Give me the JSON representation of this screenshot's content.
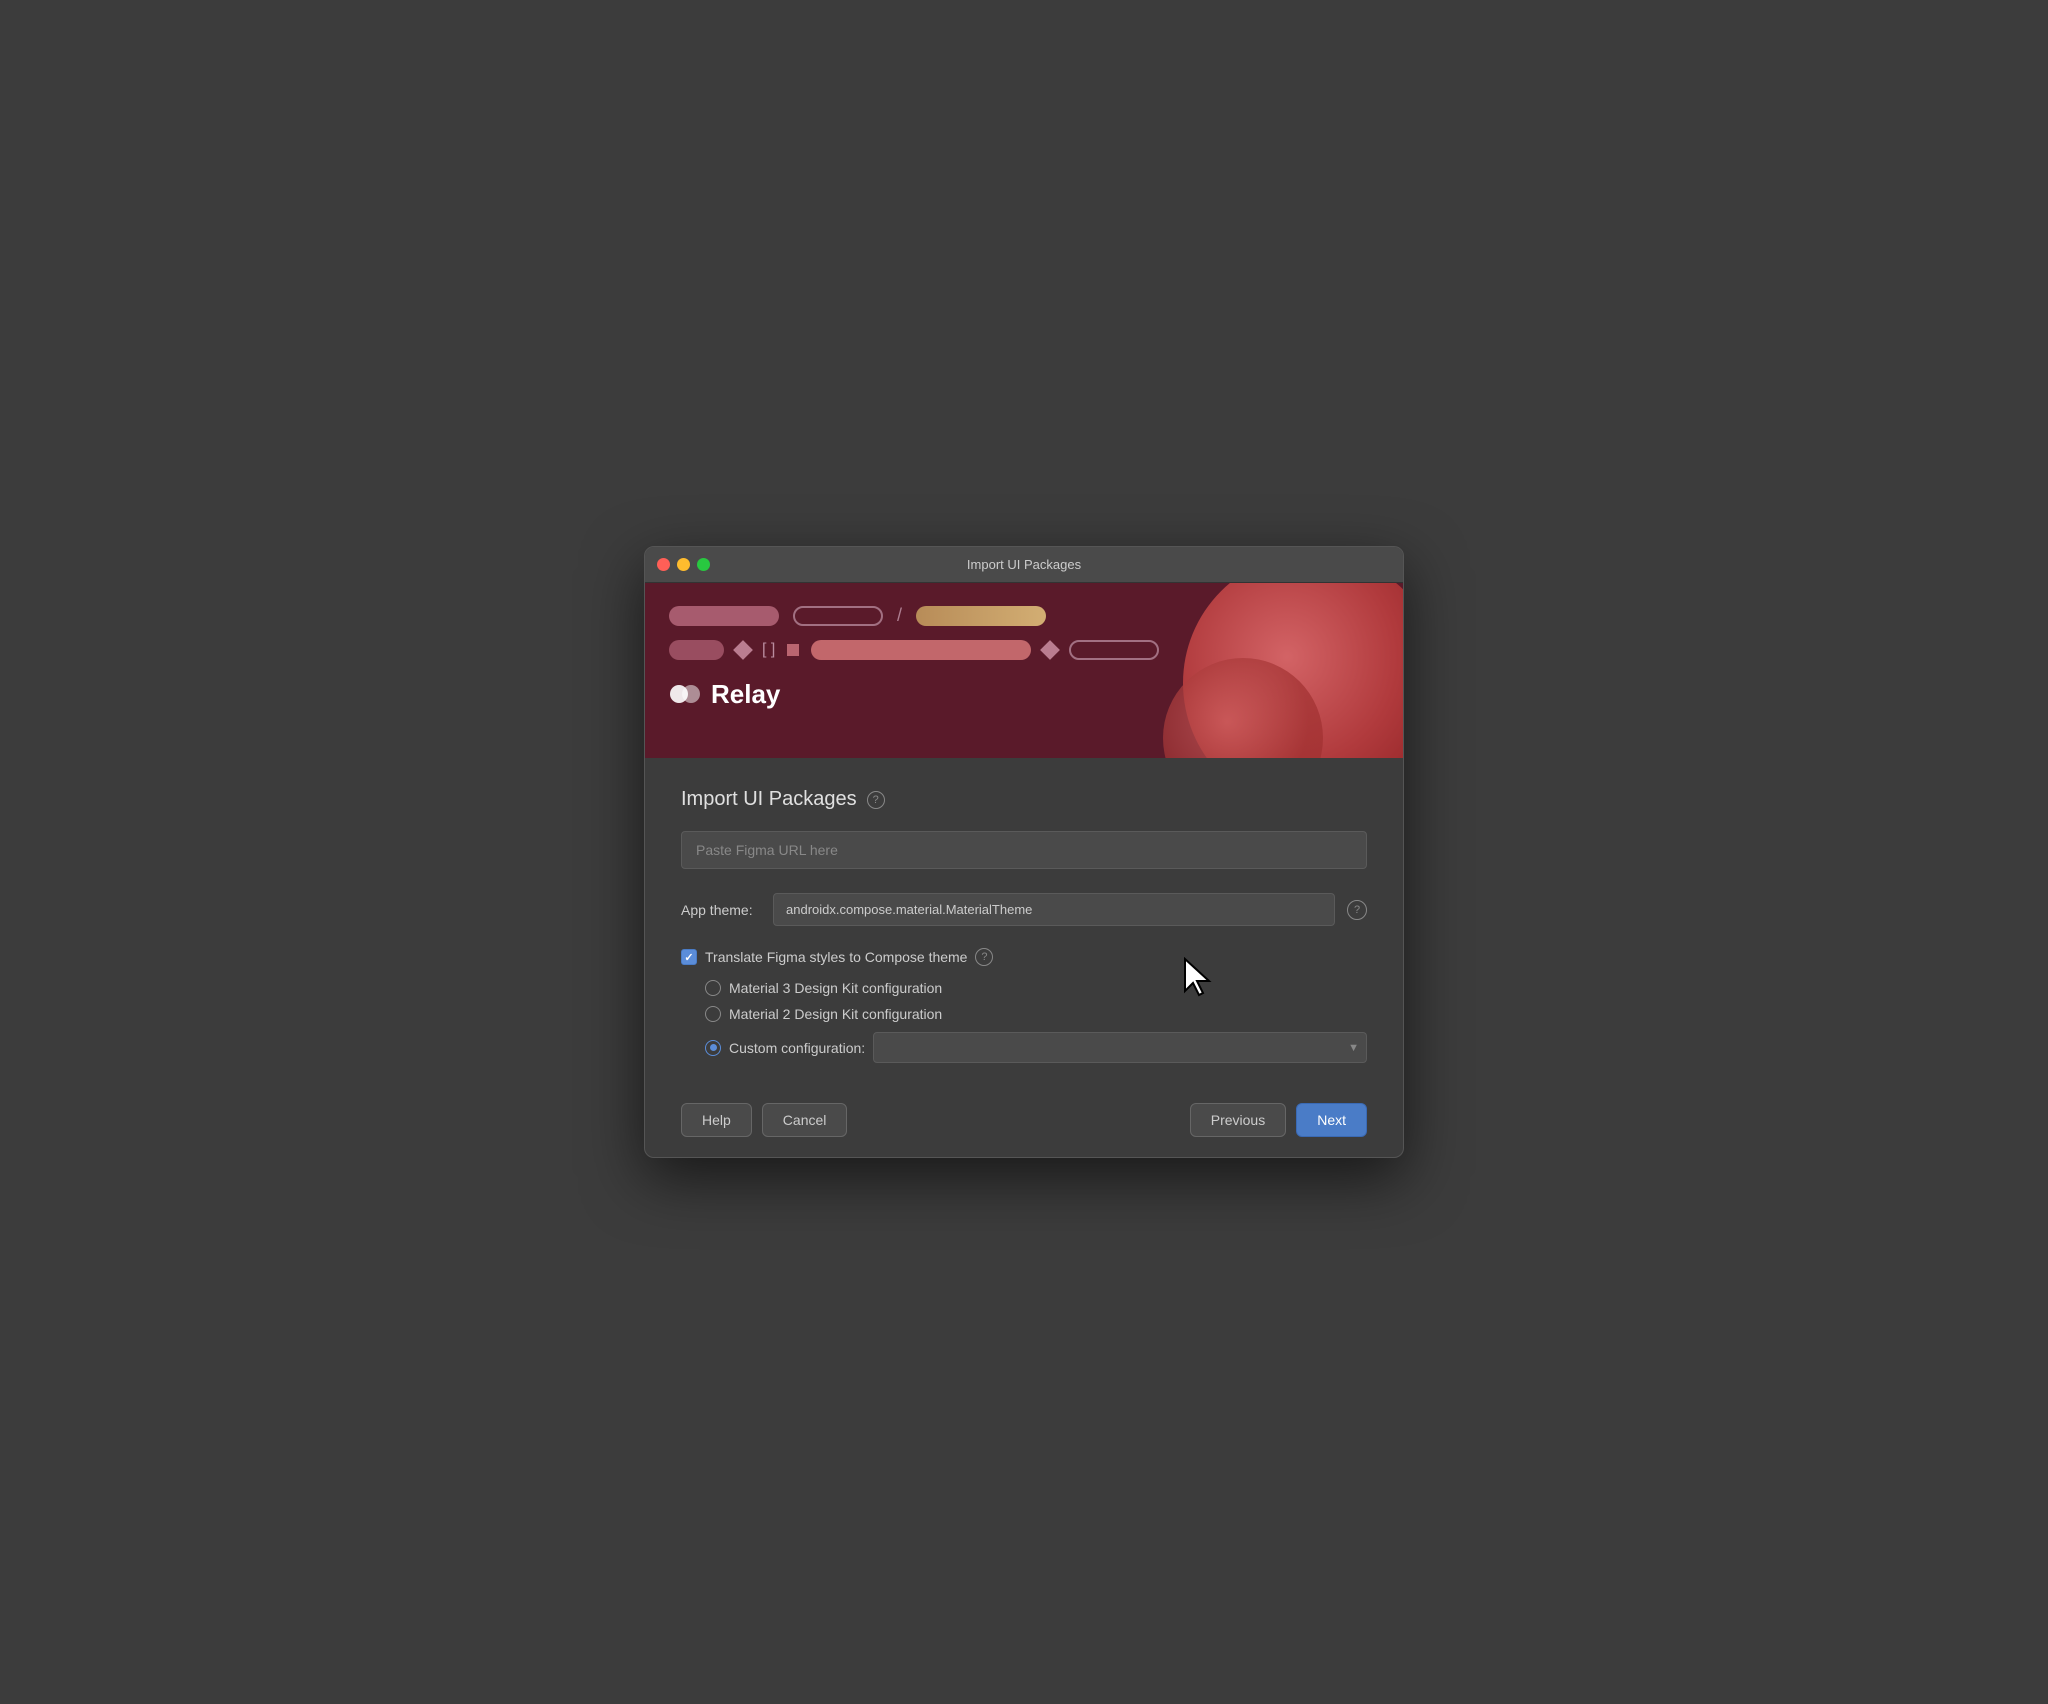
{
  "window": {
    "title": "Import UI Packages"
  },
  "hero": {
    "relay_logo_text": "Relay"
  },
  "page": {
    "title": "Import UI Packages",
    "help_icon": "?",
    "url_input_placeholder": "Paste Figma URL here",
    "app_theme_label": "App theme:",
    "app_theme_value": "androidx.compose.material.MaterialTheme",
    "app_theme_help": "?",
    "translate_checkbox_label": "Translate Figma styles to Compose theme",
    "translate_help": "?",
    "radio_material3_label": "Material 3 Design Kit configuration",
    "radio_material2_label": "Material 2 Design Kit configuration",
    "radio_custom_label": "Custom configuration:",
    "custom_config_value": ""
  },
  "footer": {
    "help_label": "Help",
    "cancel_label": "Cancel",
    "previous_label": "Previous",
    "next_label": "Next"
  }
}
